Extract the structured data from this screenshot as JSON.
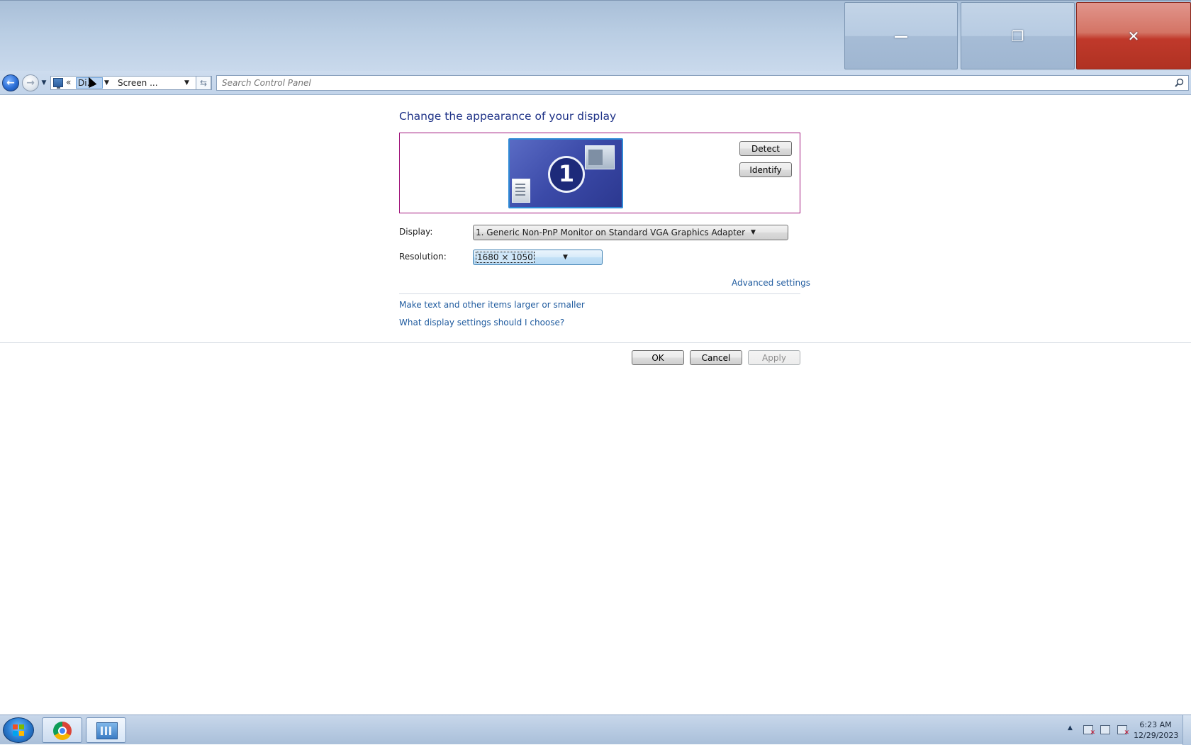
{
  "window": {
    "minimize_glyph": "—",
    "restore_glyph": "❐",
    "close_glyph": "✕"
  },
  "nav": {
    "back_glyph": "←",
    "forward_glyph": "→",
    "recent_glyph": "▼",
    "address": {
      "chevron": "«",
      "crumb_selected": "Di...",
      "crumb_current": "Screen ...",
      "dropdown_glyph": "▼"
    },
    "refresh_glyph": "⇆",
    "search_placeholder": "Search Control Panel"
  },
  "content": {
    "title": "Change the appearance of your display",
    "monitor_number": "1",
    "detect_label": "Detect",
    "identify_label": "Identify",
    "display_label": "Display:",
    "display_value": "1. Generic Non-PnP Monitor on Standard VGA Graphics Adapter",
    "resolution_label": "Resolution:",
    "resolution_value": "1680 × 1050",
    "advanced_link": "Advanced settings",
    "larger_link": "Make text and other items larger or smaller",
    "which_link": "What display settings should I choose?",
    "ok_label": "OK",
    "cancel_label": "Cancel",
    "apply_label": "Apply"
  },
  "taskbar": {
    "time": "6:23 AM",
    "date": "12/29/2023"
  },
  "colors": {
    "title_text": "#1e3287",
    "link": "#1e5a9e",
    "panel_border": "#a1167c",
    "close_button": "#c0392b"
  }
}
